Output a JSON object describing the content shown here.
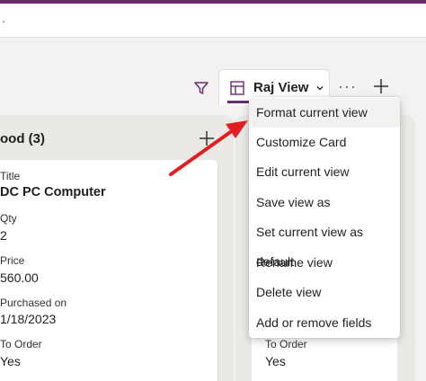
{
  "app": {
    "accent": "#6b2c6e",
    "dot": "."
  },
  "toolbar": {
    "filter_icon": "filter-icon",
    "view_name": "Raj View",
    "more_label": "···",
    "add_icon": "plus-icon"
  },
  "board": {
    "column_title": "ood (3)",
    "card": {
      "title_label": "Title",
      "title_value": "DC PC Computer",
      "qty_label": "Qty",
      "qty_value": "2",
      "price_label": "Price",
      "price_value": "560.00",
      "purchased_label": "Purchased on",
      "purchased_value": "1/18/2023",
      "order_label": "To Order",
      "order_value": "Yes"
    },
    "card2": {
      "order_label": "To Order",
      "order_value": "Yes"
    }
  },
  "menu": {
    "items": [
      "Format current view",
      "Customize Card",
      "Edit current view",
      "Save view as",
      "Set current view as default",
      "Rename view",
      "Delete view",
      "Add or remove fields"
    ]
  },
  "annotation": {
    "arrow_color": "#e02020"
  }
}
